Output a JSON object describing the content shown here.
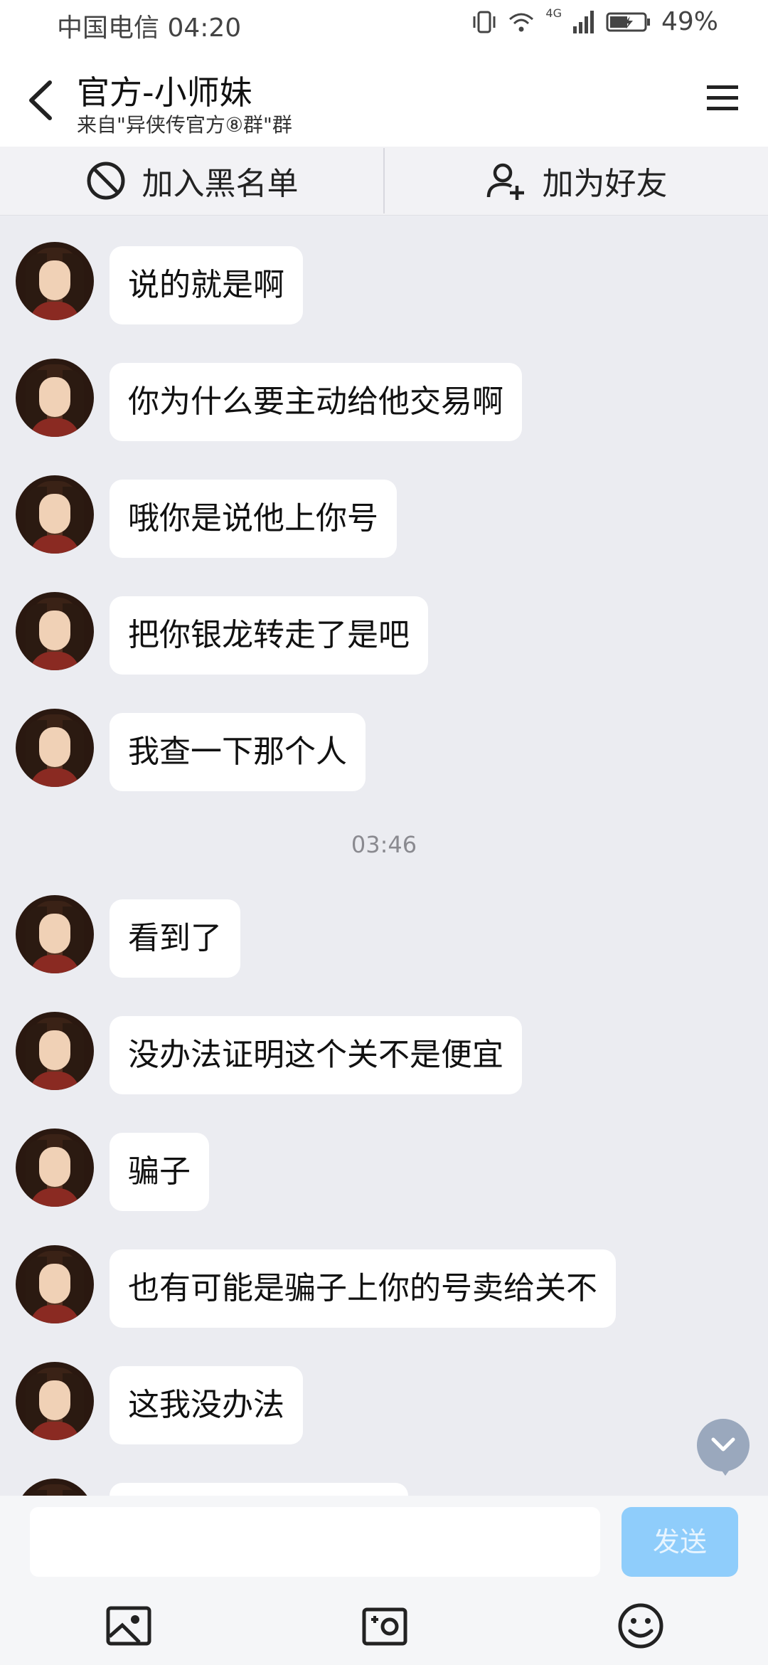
{
  "status_bar": {
    "carrier": "中国电信",
    "time": "04:20",
    "network": "4G",
    "battery": "49%"
  },
  "header": {
    "title": "官方-小师妹",
    "subtitle": "来自\"异侠传官方⑧群\"群"
  },
  "actions": {
    "block": "加入黑名单",
    "add_friend": "加为好友"
  },
  "messages": [
    {
      "text": "说的就是啊"
    },
    {
      "text": "你为什么要主动给他交易啊"
    },
    {
      "text": "哦你是说他上你号"
    },
    {
      "text": "把你银龙转走了是吧"
    },
    {
      "text": "我查一下那个人"
    },
    {
      "text": "看到了"
    },
    {
      "text": "没办法证明这个关不是便宜"
    },
    {
      "text": "骗子"
    },
    {
      "text": "也有可能是骗子上你的号卖给关不"
    },
    {
      "text": "这我没办法"
    }
  ],
  "timestamp": "03:46",
  "composer": {
    "send_label": "发送"
  },
  "icons": {
    "back": "back-arrow-icon",
    "menu": "hamburger-menu-icon",
    "block": "block-icon",
    "add_friend": "add-friend-icon",
    "scroll_down": "chevron-down-icon",
    "image": "image-icon",
    "camera": "camera-icon",
    "emoji": "emoji-icon"
  },
  "colors": {
    "chat_background": "#ebecf1",
    "send_button": "#8fcdfb",
    "bubble": "#ffffff"
  }
}
